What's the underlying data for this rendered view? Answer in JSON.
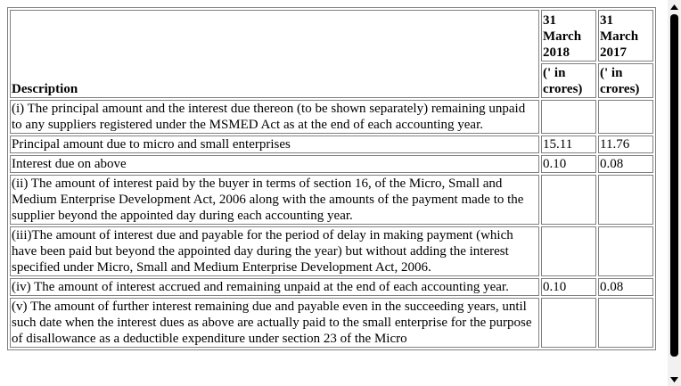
{
  "table": {
    "header": {
      "description": "Description",
      "col1_date": "31 March 2018",
      "col2_date": "31 March 2017",
      "col1_unit": "(' in crores)",
      "col2_unit": "(' in crores)"
    },
    "rows": [
      {
        "description": "(i) The principal amount and the interest due thereon (to be shown separately) remaining unpaid to any suppliers registered under the MSMED Act as at the end of each accounting year.",
        "v2018": "",
        "v2017": ""
      },
      {
        "description": "Principal amount due to micro and small enterprises",
        "v2018": "15.11",
        "v2017": "11.76"
      },
      {
        "description": "Interest due on above",
        "v2018": "0.10",
        "v2017": "0.08"
      },
      {
        "description": "(ii) The amount of interest paid by the buyer in terms of section 16, of the Micro, Small and Medium Enterprise Development Act, 2006 along with the amounts of the payment made to the supplier beyond the appointed day during each accounting year.",
        "v2018": "",
        "v2017": ""
      },
      {
        "description": "(iii)The amount of interest due and payable for the period of delay in making payment (which have been paid but beyond the appointed day during the year) but without adding the interest specified under Micro, Small and Medium Enterprise Development Act, 2006.",
        "v2018": "",
        "v2017": ""
      },
      {
        "description": "(iv) The amount of interest accrued and remaining unpaid at the end of each accounting year.",
        "v2018": "0.10",
        "v2017": "0.08"
      },
      {
        "description": "(v) The amount of further interest remaining due and payable even in the succeeding years, until such date when the interest dues as above are actually paid to the small enterprise for the purpose of disallowance as a deductible expenditure under section 23 of the Micro",
        "v2018": "",
        "v2017": ""
      }
    ]
  },
  "scrollbar": {
    "up_icon": "triangle-up-icon",
    "down_icon": "triangle-down-icon",
    "thumb_color": "#000000",
    "track_color": "#f1f1f1"
  }
}
